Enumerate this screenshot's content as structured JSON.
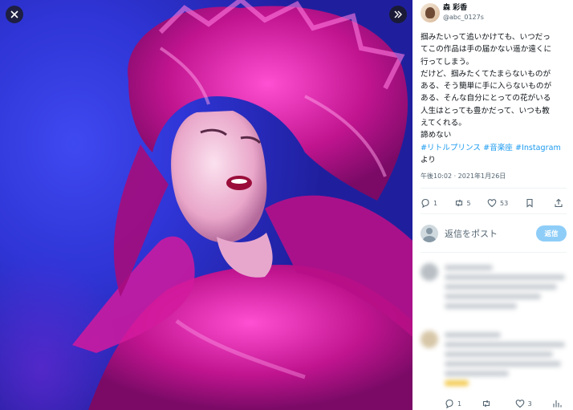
{
  "media": {
    "close_icon": "close-icon",
    "expand_icon": "chevrons-right-icon",
    "colors": {
      "stage_blue": "#2f35d6",
      "costume_magenta": "#c81a9a"
    }
  },
  "post": {
    "display_name": "森 彩香",
    "handle": "@abc_0127s",
    "text_lines": [
      "掴みたいって追いかけても、いつだっ",
      "てこの作品は手の届かない遥か遠くに",
      "行ってしまう。",
      "だけど、掴みたくてたまらないものが",
      "ある、そう簡単に手に入らないものが",
      "ある、そんな自分にとっての花がいる",
      "人生はとっても豊かだって、いつも教",
      "えてくれる。",
      "諦めない"
    ],
    "hashtags": [
      "#リトルプリンス",
      "#音楽座",
      "#Instagram"
    ],
    "after_tags": "より",
    "timestamp": "午後10:02 · 2021年1月26日",
    "metrics": {
      "replies": "1",
      "reposts": "5",
      "likes": "53",
      "bookmarks": "",
      "share": ""
    }
  },
  "reply": {
    "placeholder": "返信をポスト",
    "button": "返信"
  },
  "blurred_reply_metrics": {
    "replies": "1",
    "reposts": "",
    "likes": "3"
  }
}
